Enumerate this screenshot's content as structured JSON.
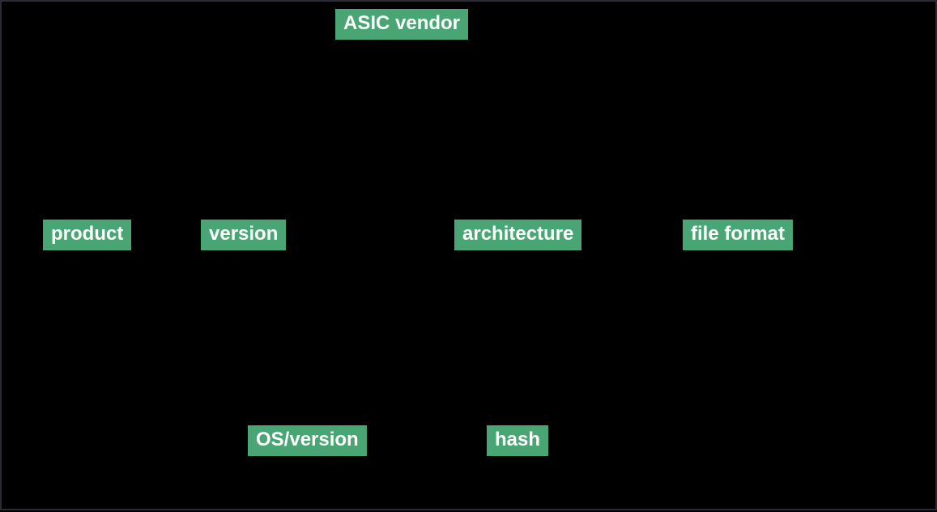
{
  "diagram": {
    "nodes": {
      "asic_vendor": "ASIC vendor",
      "product": "product",
      "version": "version",
      "architecture": "architecture",
      "file_format": "file format",
      "os_version": "OS/version",
      "hash": "hash"
    }
  }
}
